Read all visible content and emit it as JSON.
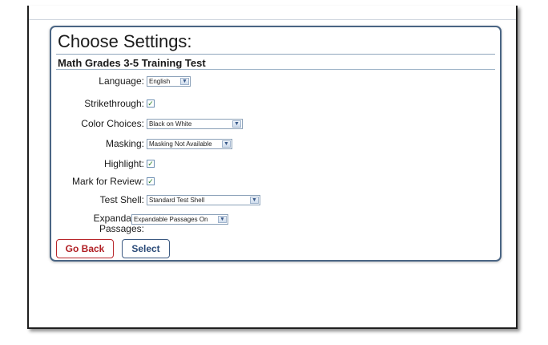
{
  "page": {
    "title": "Choose Settings:",
    "test_name": "Math Grades 3-5 Training Test"
  },
  "settings": {
    "language": {
      "label": "Language:",
      "value": "English"
    },
    "strikethrough": {
      "label": "Strikethrough:",
      "checked": true
    },
    "color_choices": {
      "label": "Color Choices:",
      "value": "Black on White"
    },
    "masking": {
      "label": "Masking:",
      "value": "Masking Not Available"
    },
    "highlight": {
      "label": "Highlight:",
      "checked": true
    },
    "mark_for_review": {
      "label": "Mark for Review:",
      "checked": true
    },
    "test_shell": {
      "label": "Test Shell:",
      "value": "Standard Test Shell"
    },
    "expandable_passages": {
      "label_line1": "Expandable",
      "label_line2": "Passages:",
      "value": "Expandable Passages On"
    }
  },
  "buttons": {
    "back_label": "Go Back",
    "select_label": "Select"
  },
  "colors": {
    "panel_border": "#4a6584",
    "back_button": "#b01e23",
    "select_button": "#2a4a78",
    "check": "#1e7a1e"
  },
  "icons": {
    "dropdown": "chevron-down-icon",
    "check": "checkmark-icon"
  }
}
